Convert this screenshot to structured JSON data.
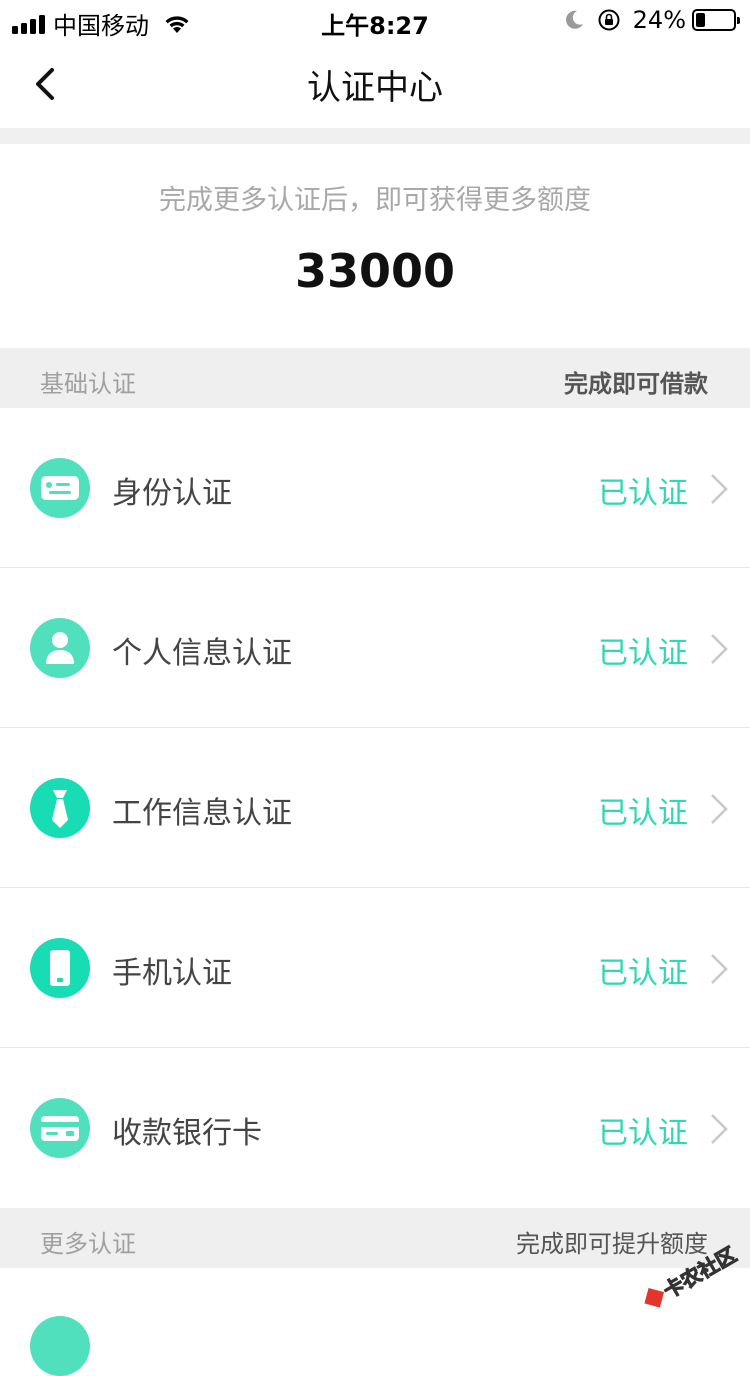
{
  "status_bar": {
    "carrier": "中国移动",
    "time": "上午8:27",
    "battery_percent_text": "24%",
    "battery_level": 0.24
  },
  "nav": {
    "title": "认证中心",
    "back_icon": "chevron-left-icon"
  },
  "hero": {
    "subtitle": "完成更多认证后，即可获得更多额度",
    "amount": "33000"
  },
  "basic_section": {
    "title": "基础认证",
    "note": "完成即可借款",
    "items": [
      {
        "label": "身份认证",
        "status": "已认证",
        "icon": "id-card-icon"
      },
      {
        "label": "个人信息认证",
        "status": "已认证",
        "icon": "person-icon"
      },
      {
        "label": "工作信息认证",
        "status": "已认证",
        "icon": "tie-icon"
      },
      {
        "label": "手机认证",
        "status": "已认证",
        "icon": "phone-icon"
      },
      {
        "label": "收款银行卡",
        "status": "已认证",
        "icon": "bank-card-icon"
      }
    ]
  },
  "more_section": {
    "title": "更多认证",
    "note": "完成即可提升额度"
  },
  "watermark": {
    "text": "卡农社区"
  },
  "colors": {
    "accent": "#2fd8b4",
    "icon_bg": "#51e0bd",
    "section_bg": "#efefef"
  }
}
